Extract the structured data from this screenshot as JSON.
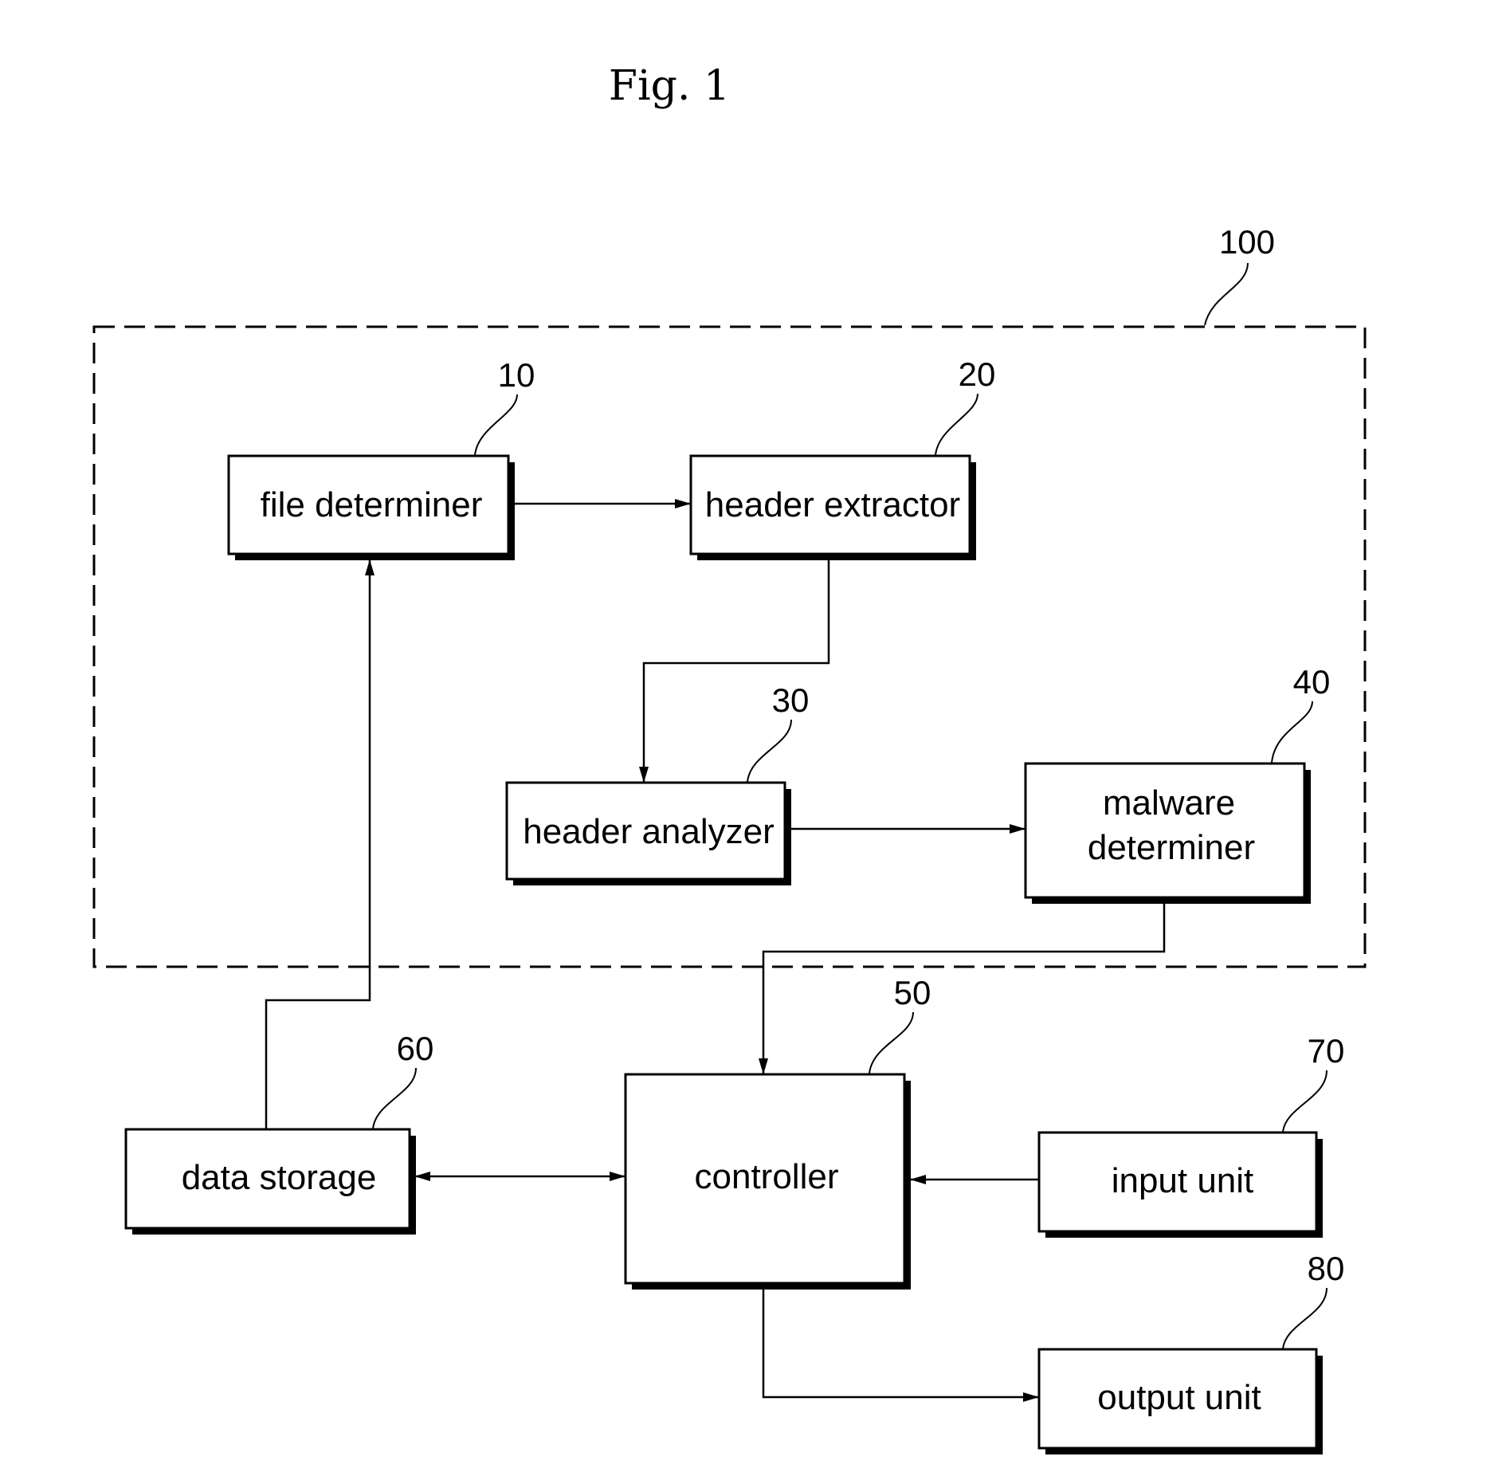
{
  "figure": {
    "title": "Fig. 1"
  },
  "system": {
    "ref": "100"
  },
  "blocks": {
    "file_determiner": {
      "ref": "10",
      "lines": [
        "file determiner"
      ]
    },
    "header_extractor": {
      "ref": "20",
      "lines": [
        "header extractor"
      ]
    },
    "header_analyzer": {
      "ref": "30",
      "lines": [
        "header analyzer"
      ]
    },
    "malware_determiner": {
      "ref": "40",
      "lines": [
        "malware",
        "determiner"
      ]
    },
    "controller": {
      "ref": "50",
      "lines": [
        "controller"
      ]
    },
    "data_storage": {
      "ref": "60",
      "lines": [
        "data storage"
      ]
    },
    "input_unit": {
      "ref": "70",
      "lines": [
        "input unit"
      ]
    },
    "output_unit": {
      "ref": "80",
      "lines": [
        "output unit"
      ]
    }
  },
  "connections": [
    {
      "from": "file_determiner",
      "to": "header_extractor",
      "direction": "one-way"
    },
    {
      "from": "header_extractor",
      "to": "header_analyzer",
      "direction": "one-way"
    },
    {
      "from": "header_analyzer",
      "to": "malware_determiner",
      "direction": "one-way"
    },
    {
      "from": "malware_determiner",
      "to": "controller",
      "direction": "one-way"
    },
    {
      "from": "data_storage",
      "to": "file_determiner",
      "direction": "one-way"
    },
    {
      "from": "data_storage",
      "to": "controller",
      "direction": "two-way"
    },
    {
      "from": "input_unit",
      "to": "controller",
      "direction": "one-way"
    },
    {
      "from": "controller",
      "to": "output_unit",
      "direction": "one-way"
    }
  ]
}
